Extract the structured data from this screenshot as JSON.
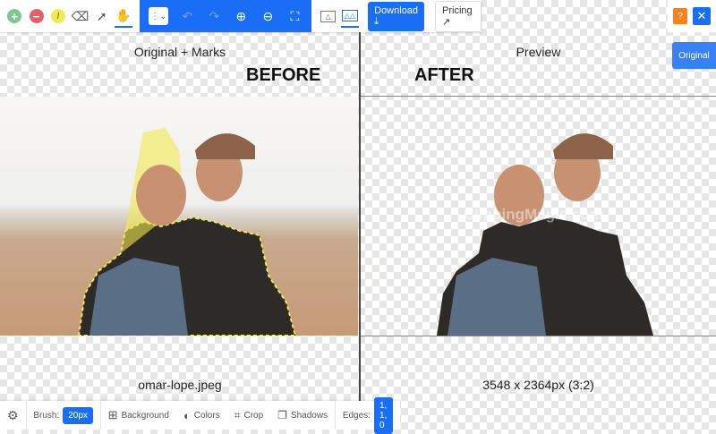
{
  "toolbar": {
    "download_label": "Download",
    "download_icon": "download-icon",
    "pricing_label": "Pricing",
    "pricing_icon": "external-link-icon",
    "help_label": "?",
    "close_label": "✕",
    "original_label": "Original"
  },
  "left_panel": {
    "title": "Original + Marks",
    "annotation": "BEFORE",
    "filename": "omar-lope.jpeg"
  },
  "right_panel": {
    "title": "Preview",
    "annotation": "AFTER",
    "watermark": "ClippingMagic.com",
    "dimensions": "3548 x 2364px (3:2)"
  },
  "bottom_bar": {
    "brush_label": "Brush:",
    "brush_value": "20px",
    "background_label": "Background",
    "colors_label": "Colors",
    "crop_label": "Crop",
    "shadows_label": "Shadows",
    "edges_label": "Edges:",
    "edges_value": "1, 1, 0"
  },
  "colors": {
    "accent": "#1a6ef5",
    "help": "#f5821f",
    "keep": "#7cc98f",
    "remove": "#e0606c",
    "hair": "#f2e94e"
  }
}
